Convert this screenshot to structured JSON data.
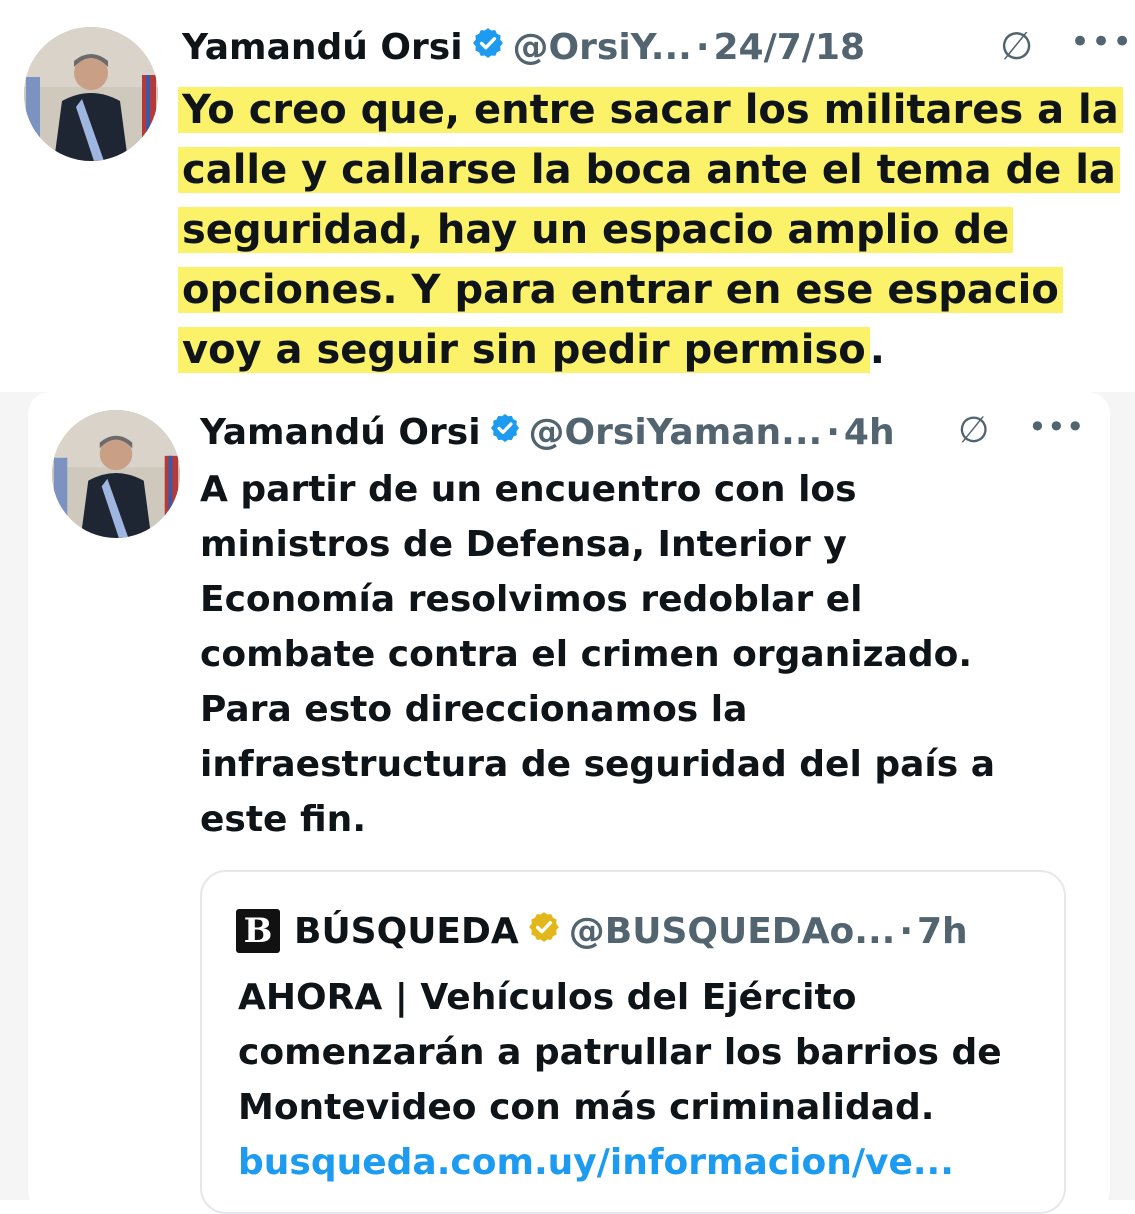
{
  "tweet1": {
    "name": "Yamandú Orsi",
    "handle": "@OrsiY...",
    "separator": "·",
    "time": "24/7/18",
    "lines": [
      "Yo creo que, entre sacar los militares a la",
      "calle y callarse la boca ante el tema de la",
      "seguridad, hay un espacio amplio de",
      "opciones. Y para entrar en ese espacio",
      "voy a seguir sin pedir permiso",
      "."
    ],
    "highlight_color": "#fbf26a"
  },
  "tweet2": {
    "name": "Yamandú Orsi",
    "handle": "@OrsiYaman...",
    "separator": "·",
    "time": "4h",
    "lines": [
      "A partir de un encuentro con los",
      "ministros de Defensa, Interior y",
      "Economía resolvimos redoblar el",
      "combate contra el crimen organizado.",
      "Para esto direccionamos la",
      "infraestructura de seguridad del país a",
      "este fin."
    ]
  },
  "quote": {
    "logo_letter": "B",
    "name": "BÚSQUEDA",
    "handle": "@BUSQUEDAo...",
    "separator": "·",
    "time": "7h",
    "lines": [
      "AHORA | Vehículos del Ejército",
      "comenzarán a patrullar los barrios de",
      "Montevideo con más criminalidad."
    ],
    "link": "busqueda.com.uy/informacion/ve..."
  },
  "icons": {
    "more": "•••",
    "grok": "∅"
  },
  "colors": {
    "verified_blue": "#1d9bf0",
    "verified_gold": "#e2b719",
    "link": "#1d9bf0",
    "secondary_text": "#536471"
  }
}
